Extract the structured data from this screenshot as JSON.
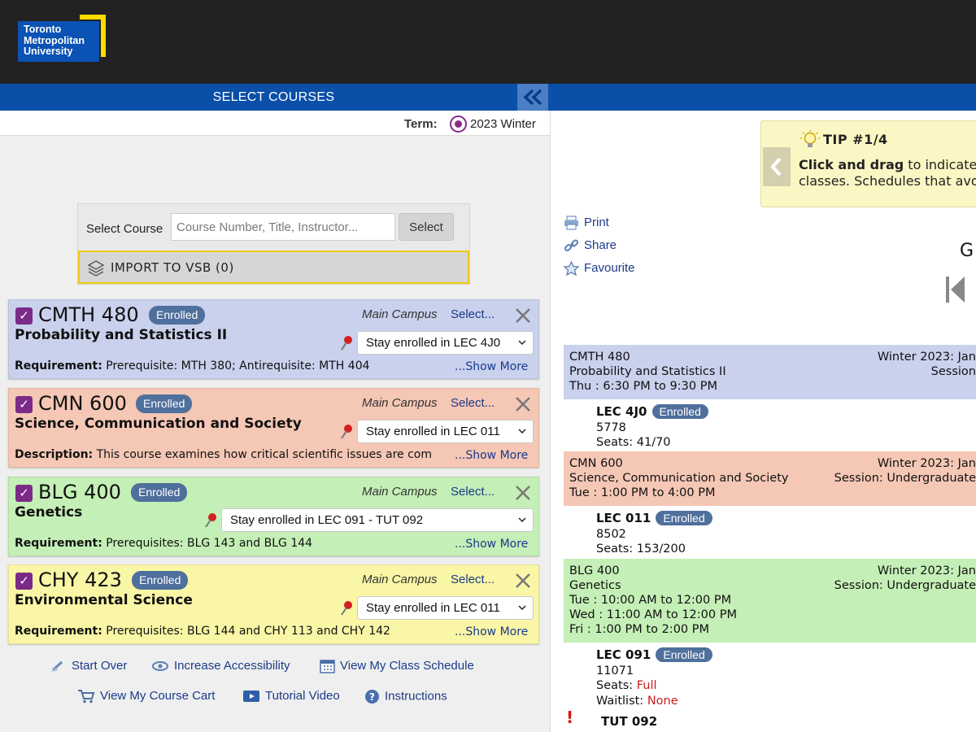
{
  "header": {
    "logo_text": "Toronto\nMetropolitan\nUniversity",
    "section_title": "SELECT COURSES",
    "brand_color": "#0a4fa8"
  },
  "term": {
    "label": "Term:",
    "value": "2023 Winter"
  },
  "select_course": {
    "label": "Select Course",
    "placeholder": "Course Number, Title, Instructor...",
    "button": "Select",
    "import_label": "IMPORT TO VSB (0)"
  },
  "courses": [
    {
      "code": "CMTH 480",
      "status": "Enrolled",
      "name": "Probability and Statistics II",
      "campus": "Main Campus",
      "select": "Select...",
      "dropdown": "Stay enrolled in LEC 4J0",
      "info_label": "Requirement:",
      "info_text": " Prerequisite: MTH 380; Antirequisite: MTH 404",
      "more": "...Show More",
      "color": "#c9d1ed"
    },
    {
      "code": "CMN 600",
      "status": "Enrolled",
      "name": "Science, Communication and Society",
      "campus": "Main Campus",
      "select": "Select...",
      "dropdown": "Stay enrolled in LEC 011",
      "info_label": "Description:",
      "info_text": " This course examines how critical scientific issues are com",
      "more": "...Show More",
      "color": "#f5c7b5"
    },
    {
      "code": "BLG 400",
      "status": "Enrolled",
      "name": "Genetics",
      "campus": "Main Campus",
      "select": "Select...",
      "dropdown": "Stay enrolled in LEC 091 - TUT 092",
      "info_label": "Requirement:",
      "info_text": " Prerequisites: BLG 143 and BLG 144",
      "more": "...Show More",
      "color": "#c4efb6"
    },
    {
      "code": "CHY 423",
      "status": "Enrolled",
      "name": "Environmental Science",
      "campus": "Main Campus",
      "select": "Select...",
      "dropdown": "Stay enrolled in LEC 011",
      "info_label": "Requirement:",
      "info_text": " Prerequisites: BLG 144 and CHY 113 and CHY 142",
      "more": "...Show More",
      "color": "#f9f6a6"
    }
  ],
  "bottom_links": {
    "start_over": "Start Over",
    "accessibility": "Increase Accessibility",
    "class_schedule": "View My Class Schedule",
    "course_cart": "View My Course Cart",
    "tutorial": "Tutorial Video",
    "instructions": "Instructions"
  },
  "tip": {
    "title": "TIP #1/4",
    "bold": "Click and drag",
    "text1": " to indicate",
    "text2": "classes. Schedules that avo"
  },
  "right_links": {
    "print": "Print",
    "share": "Share",
    "favourite": "Favourite"
  },
  "right_partial": "G",
  "schedule": [
    {
      "code": "CMTH 480",
      "name": "Probability and Statistics II",
      "times": [
        "Thu : 6:30 PM to 9:30 PM"
      ],
      "term": "Winter 2023: Jan",
      "session": "Session",
      "section": {
        "name": "LEC 4J0",
        "status": "Enrolled",
        "crn": "5778",
        "seats_label": "Seats:",
        "seats": "41/70"
      }
    },
    {
      "code": "CMN 600",
      "name": "Science, Communication and Society",
      "times": [
        "Tue : 1:00 PM to 4:00 PM"
      ],
      "term": "Winter 2023: Jan",
      "session": "Session: Undergraduate",
      "section": {
        "name": "LEC 011",
        "status": "Enrolled",
        "crn": "8502",
        "seats_label": "Seats:",
        "seats": "153/200"
      }
    },
    {
      "code": "BLG 400",
      "name": "Genetics",
      "times": [
        "Tue : 10:00 AM to 12:00 PM",
        "Wed : 11:00 AM to 12:00 PM",
        "Fri : 1:00 PM to 2:00 PM"
      ],
      "term": "Winter 2023: Jan",
      "session": "Session: Undergraduate",
      "section": {
        "name": "LEC 091",
        "status": "Enrolled",
        "crn": "11071",
        "seats_label": "Seats:",
        "seats": "Full",
        "waitlist_label": "Waitlist:",
        "waitlist": "None"
      }
    }
  ],
  "tutorial_section": {
    "alert": "!",
    "name": "TUT 092"
  }
}
